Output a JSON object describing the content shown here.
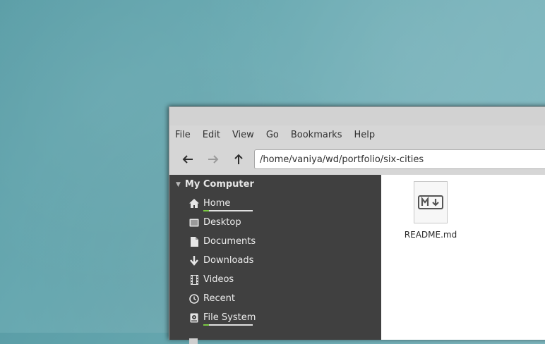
{
  "window": {
    "menu": [
      "File",
      "Edit",
      "View",
      "Go",
      "Bookmarks",
      "Help"
    ],
    "location": "/home/vaniya/wd/portfolio/six-cities"
  },
  "toolbar": {
    "back_icon": "arrow-left-icon",
    "forward_icon": "arrow-right-icon",
    "up_icon": "arrow-up-icon"
  },
  "sidebar": {
    "section_title": "My Computer",
    "items": [
      {
        "label": "Home",
        "icon": "home-icon",
        "usage": 0.12
      },
      {
        "label": "Desktop",
        "icon": "desktop-icon"
      },
      {
        "label": "Documents",
        "icon": "document-icon"
      },
      {
        "label": "Downloads",
        "icon": "download-icon"
      },
      {
        "label": "Videos",
        "icon": "video-icon"
      },
      {
        "label": "Recent",
        "icon": "clock-icon"
      },
      {
        "label": "File System",
        "icon": "drive-icon",
        "usage": 0.12
      }
    ]
  },
  "files": [
    {
      "name": "README.md",
      "icon": "markdown-icon"
    }
  ],
  "colors": {
    "sidebar_bg": "#404040",
    "usage_fill": "#7ac943",
    "window_bg": "#d6d6d6"
  }
}
